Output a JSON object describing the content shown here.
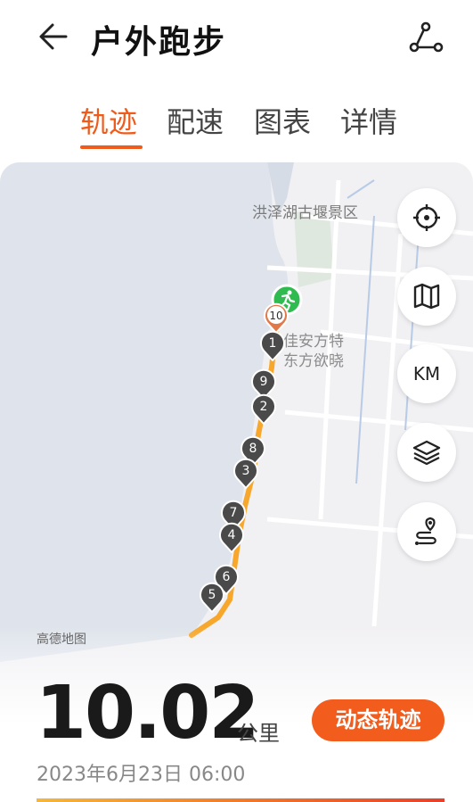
{
  "header": {
    "title": "户外跑步",
    "back_icon": "arrow-left-icon",
    "share_icon": "route-share-icon"
  },
  "tabs": [
    {
      "label": "轨迹",
      "active": true
    },
    {
      "label": "配速",
      "active": false
    },
    {
      "label": "图表",
      "active": false
    },
    {
      "label": "详情",
      "active": false
    }
  ],
  "map": {
    "labels": {
      "scenic": "洪泽湖古堰景区",
      "poi_line1": "佳安方特",
      "poi_line2": "东方欲晓"
    },
    "attribution": "高德地图",
    "start_icon": "running-person-icon",
    "markers": [
      "10",
      "1",
      "9",
      "2",
      "8",
      "3",
      "7",
      "4",
      "6",
      "5"
    ],
    "controls": [
      {
        "name": "locate",
        "icon": "target-icon"
      },
      {
        "name": "map-style",
        "icon": "map-icon"
      },
      {
        "name": "km-toggle",
        "label": "KM"
      },
      {
        "name": "layers",
        "icon": "layers-icon"
      },
      {
        "name": "route",
        "icon": "route-pin-icon"
      }
    ],
    "colors": {
      "water": "#dfe4ec",
      "land": "#f1f0f3",
      "route": "#f7a72b",
      "accent": "#f05a1a",
      "start": "#2fbb4f"
    }
  },
  "summary": {
    "distance": "10.02",
    "unit": "公里",
    "replay_label": "动态轨迹",
    "datetime": "2023年6月23日 06:00"
  }
}
